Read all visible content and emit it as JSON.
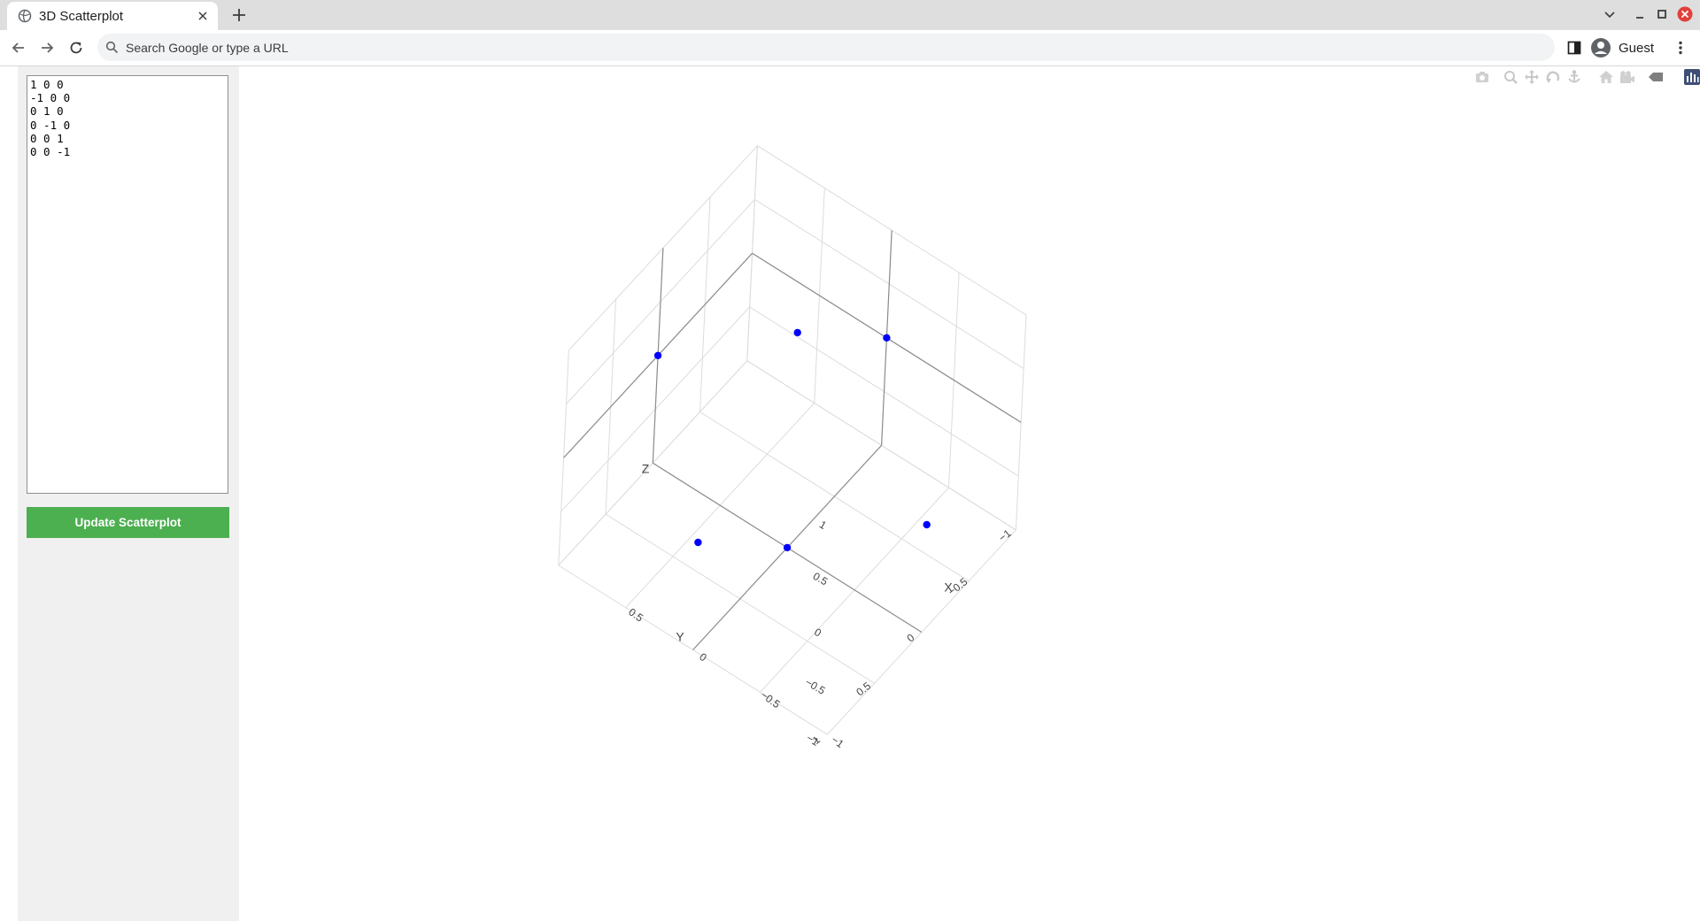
{
  "browser": {
    "tab_title": "3D Scatterplot",
    "omnibox_placeholder": "Search Google or type a URL",
    "profile_label": "Guest"
  },
  "editor": {
    "text": "1 0 0\n-1 0 0\n0 1 0\n0 -1 0\n0 0 1\n0 0 -1",
    "button_label": "Update Scatterplot"
  },
  "modebar": {
    "icons": [
      "camera-icon",
      "zoom-icon",
      "pan-icon",
      "orbit-rotation-icon",
      "turntable-rotation-icon",
      "reset-camera-icon",
      "camera-last-save-icon",
      "hover-icon",
      "plotly-logo-icon"
    ]
  },
  "chart_data": {
    "type": "scatter3d",
    "marker_color": "#0000ff",
    "points": [
      {
        "x": 1,
        "y": 0,
        "z": 0
      },
      {
        "x": -1,
        "y": 0,
        "z": 0
      },
      {
        "x": 0,
        "y": 1,
        "z": 0
      },
      {
        "x": 0,
        "y": -1,
        "z": 0
      },
      {
        "x": 0,
        "y": 0,
        "z": 1
      },
      {
        "x": 0,
        "y": 0,
        "z": -1
      }
    ],
    "axes": {
      "x": {
        "title": "X",
        "range": [
          -1,
          1
        ],
        "ticks": [
          "−1",
          "−0.5",
          "0",
          "0.5"
        ]
      },
      "y": {
        "title": "Y",
        "range": [
          -1,
          1
        ],
        "ticks": [
          "−1",
          "−0.5",
          "0",
          "0.5",
          "1"
        ]
      },
      "z": {
        "title": "Z",
        "range": [
          -1,
          1
        ],
        "ticks": [
          "−1",
          "−0.5",
          "0",
          "0.5",
          "1"
        ]
      }
    },
    "grid": true
  }
}
